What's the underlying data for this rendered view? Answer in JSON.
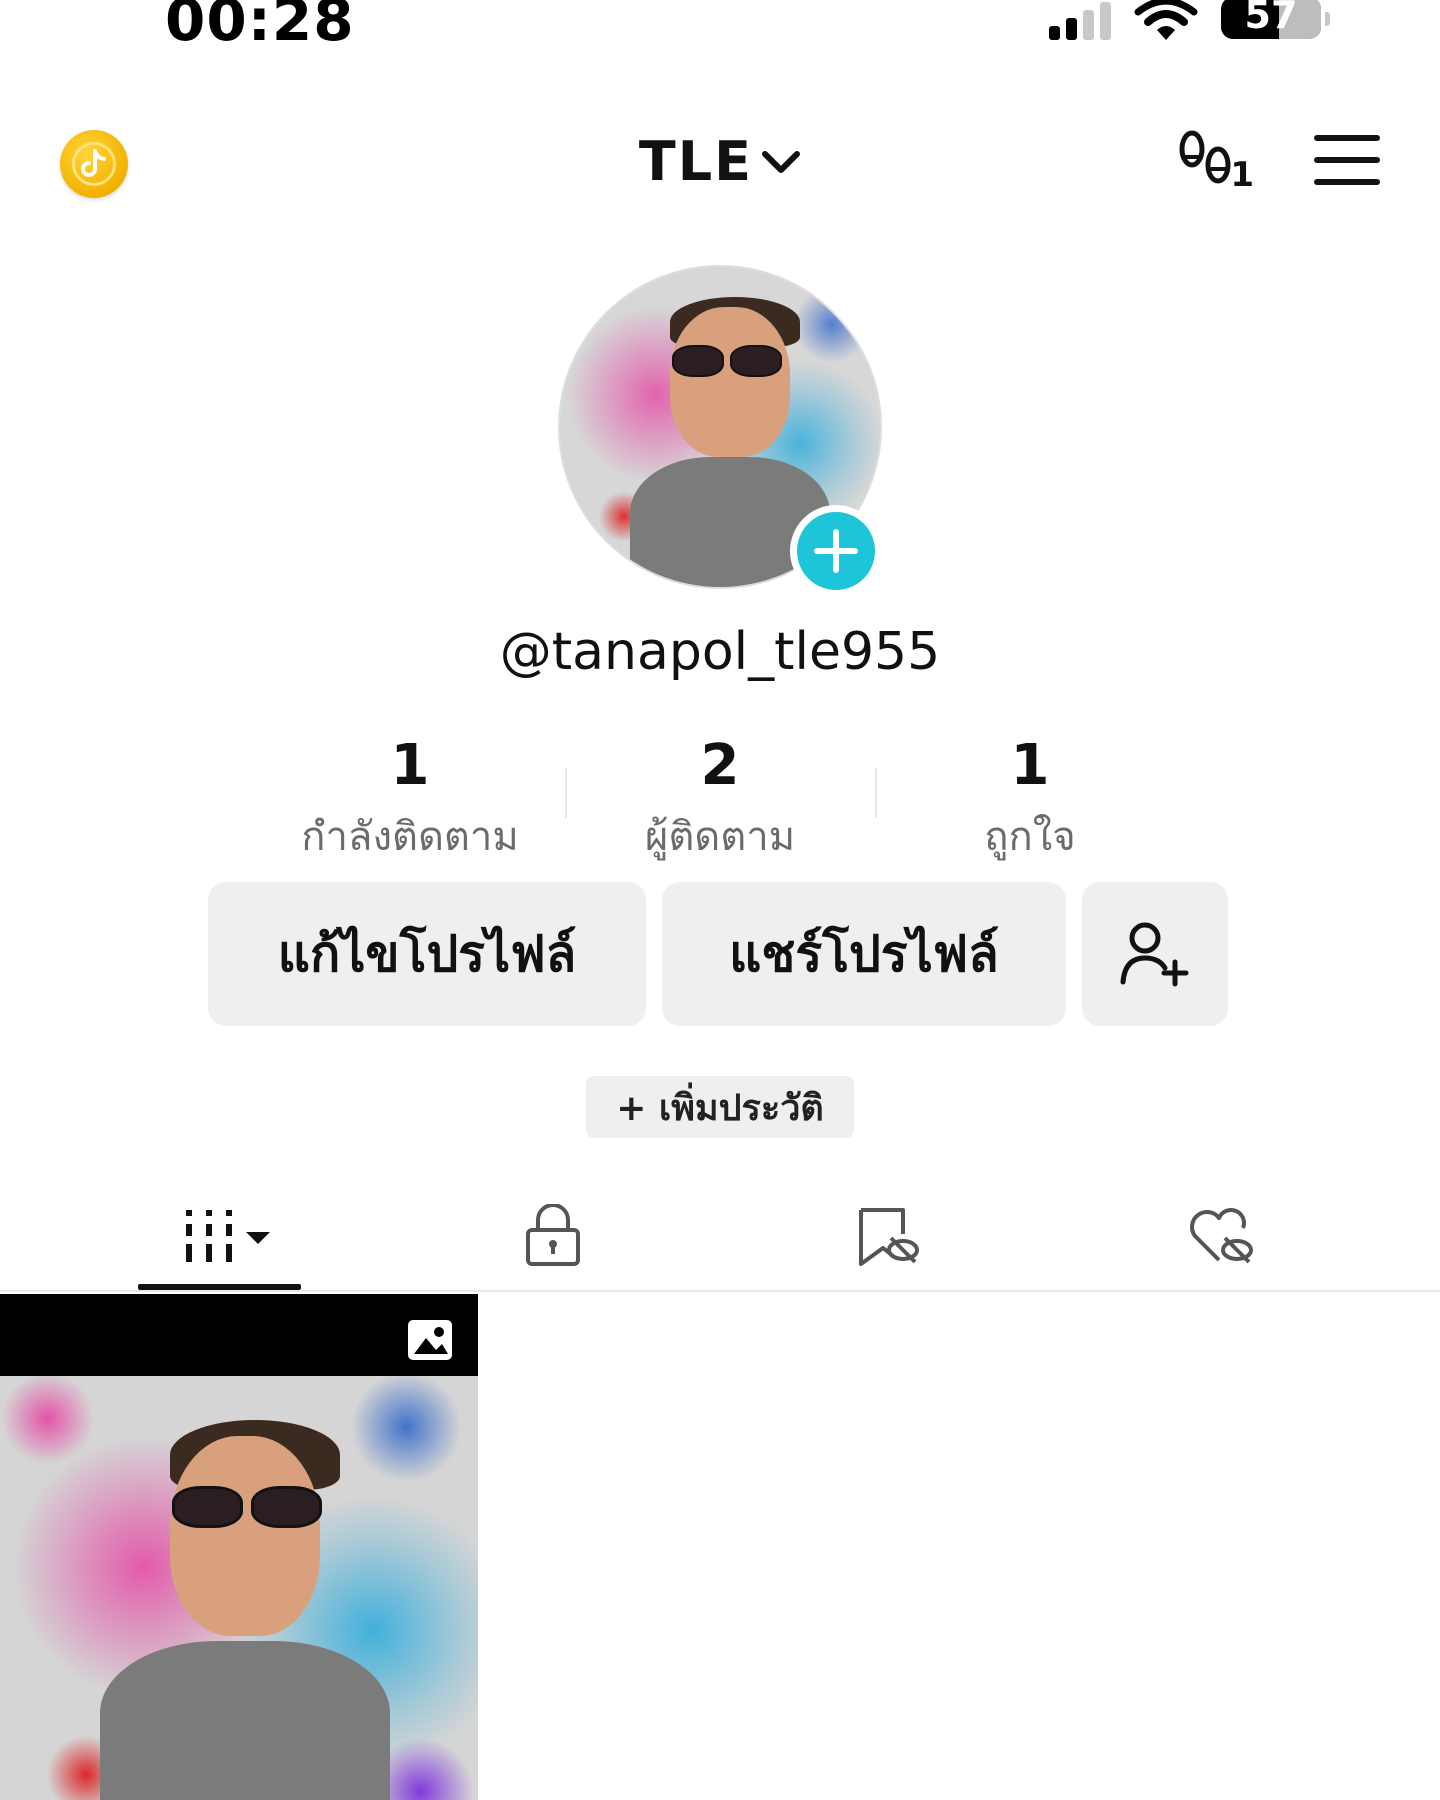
{
  "status_bar": {
    "time": "00:28",
    "battery": "57",
    "signal_level": 0.5,
    "battery_level": 0.57
  },
  "header": {
    "account_name": "TLE",
    "coin_icon": "tiktok-coin-icon",
    "footprint_icon": "footprints-icon",
    "footprint_count": "1",
    "menu_icon": "hamburger-menu-icon"
  },
  "profile": {
    "username": "@tanapol_tle955",
    "accent_color": "#1ec5d8"
  },
  "stats": [
    {
      "value": "1",
      "label": "กำลังติดตาม"
    },
    {
      "value": "2",
      "label": "ผู้ติดตาม"
    },
    {
      "value": "1",
      "label": "ถูกใจ"
    }
  ],
  "actions": {
    "edit_profile": "แก้ไขโปรไฟล์",
    "share_profile": "แชร์โปรไฟล์",
    "add_friend_icon": "add-user-icon"
  },
  "bio_button": "+ เพิ่มประวัติ",
  "tabs": [
    {
      "icon": "videos-grid-icon",
      "selected": true
    },
    {
      "icon": "lock-icon",
      "selected": false
    },
    {
      "icon": "bookmark-hidden-icon",
      "selected": false
    },
    {
      "icon": "heart-hidden-icon",
      "selected": false
    }
  ],
  "grid": [
    {
      "type": "photo",
      "badge_icon": "photo-icon"
    }
  ]
}
